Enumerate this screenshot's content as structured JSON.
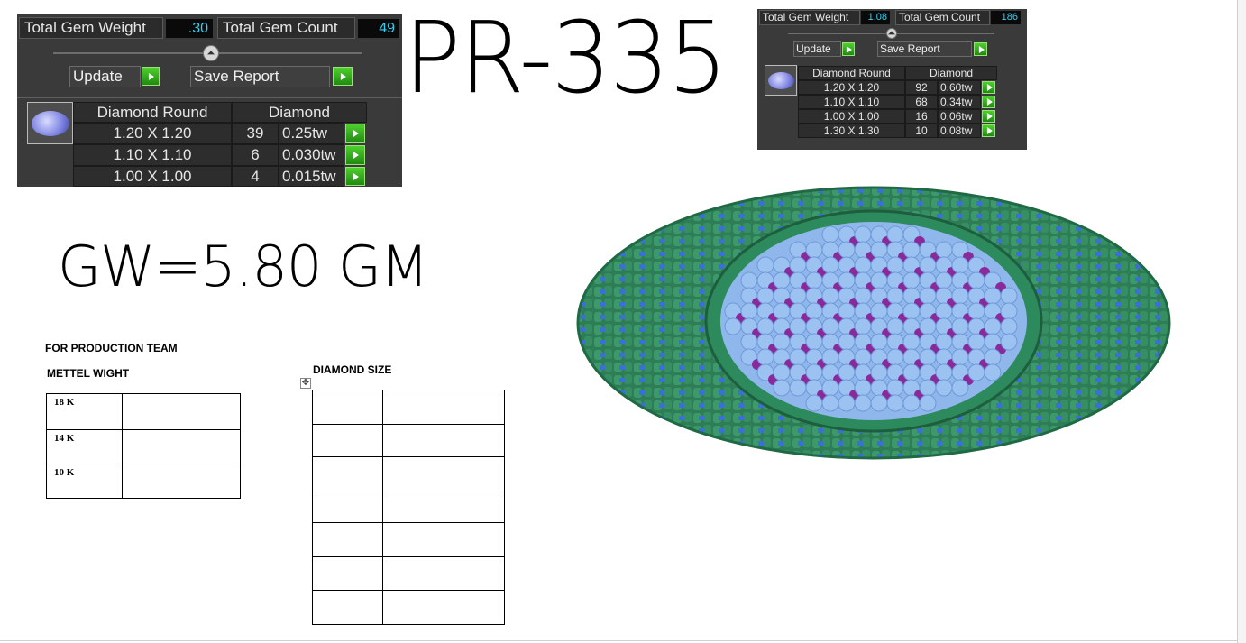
{
  "panel_large": {
    "total_gem_weight_label": "Total Gem Weight",
    "total_gem_weight_value": ".30",
    "total_gem_count_label": "Total Gem Count",
    "total_gem_count_value": "49",
    "update_label": "Update",
    "save_report_label": "Save Report",
    "col_shape": "Diamond Round",
    "col_type": "Diamond",
    "rows": [
      {
        "size": "1.20 X 1.20",
        "count": "39",
        "weight": "0.25tw"
      },
      {
        "size": "1.10 X 1.10",
        "count": "6",
        "weight": "0.030tw"
      },
      {
        "size": "1.00 X 1.00",
        "count": "4",
        "weight": "0.015tw"
      }
    ]
  },
  "panel_small": {
    "total_gem_weight_label": "Total Gem Weight",
    "total_gem_weight_value": "1.08",
    "total_gem_count_label": "Total Gem Count",
    "total_gem_count_value": "186",
    "update_label": "Update",
    "save_report_label": "Save Report",
    "col_shape": "Diamond Round",
    "col_type": "Diamond",
    "rows": [
      {
        "size": "1.20 X 1.20",
        "count": "92",
        "weight": "0.60tw"
      },
      {
        "size": "1.10 X 1.10",
        "count": "68",
        "weight": "0.34tw"
      },
      {
        "size": "1.00 X 1.00",
        "count": "16",
        "weight": "0.06tw"
      },
      {
        "size": "1.30 X 1.30",
        "count": "10",
        "weight": "0.08tw"
      }
    ]
  },
  "product_code": "PR-335",
  "gross_weight": "GW=5.80 GM",
  "production": {
    "heading": "FOR PRODUCTION TEAM",
    "metal_weight_heading": "METTEL WIGHT",
    "metal_rows": [
      "18 K",
      "14 K",
      "10 K"
    ],
    "diamond_size_heading": "DIAMOND SIZE"
  },
  "colors": {
    "accent_value": "#35d0f0",
    "go_green": "#2faa18",
    "ring_green": "#2e8a5a",
    "stone_blue": "#9cc2f2",
    "stone_purple": "#8a2a9a",
    "prong_blue": "#3b6fd6"
  }
}
